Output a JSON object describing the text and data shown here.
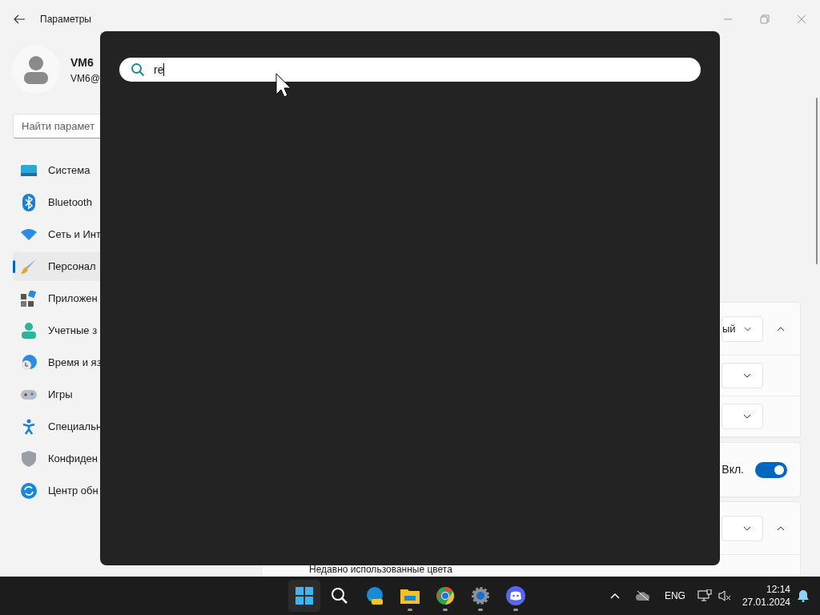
{
  "window": {
    "title": "Параметры"
  },
  "profile": {
    "name": "VM6",
    "email": "VM6@"
  },
  "search": {
    "placeholder": "Найти парамет"
  },
  "nav": [
    {
      "label": "Система",
      "selected": false
    },
    {
      "label": "Bluetooth",
      "selected": false
    },
    {
      "label": "Сеть и Инт",
      "selected": false
    },
    {
      "label": "Персонал",
      "selected": true
    },
    {
      "label": "Приложен",
      "selected": false
    },
    {
      "label": "Учетные з",
      "selected": false
    },
    {
      "label": "Время и яз",
      "selected": false
    },
    {
      "label": "Игры",
      "selected": false
    },
    {
      "label": "Специальн",
      "selected": false
    },
    {
      "label": "Конфиден",
      "selected": false
    },
    {
      "label": "Центр обн",
      "selected": false
    }
  ],
  "cards": [
    {
      "rows": [
        {
          "kind": "dropdown",
          "value": "ый",
          "expanded": true
        },
        {
          "kind": "dropdown"
        },
        {
          "kind": "dropdown"
        }
      ]
    },
    {
      "rows": [
        {
          "kind": "toggle",
          "label": "Вкл.",
          "on": true
        }
      ]
    },
    {
      "rows": [
        {
          "kind": "dropdown",
          "expanded": true
        },
        {
          "kind": "text",
          "label": "Недавно использованные цвета"
        }
      ]
    }
  ],
  "overlay": {
    "query": "re"
  },
  "taskbar": {
    "apps": [
      {
        "running": false
      },
      {
        "running": false
      },
      {
        "running": false
      },
      {
        "running": true
      },
      {
        "running": true
      },
      {
        "running": true
      },
      {
        "running": true
      }
    ],
    "language": "ENG",
    "time": "12:14",
    "date": "27.01.2024"
  }
}
